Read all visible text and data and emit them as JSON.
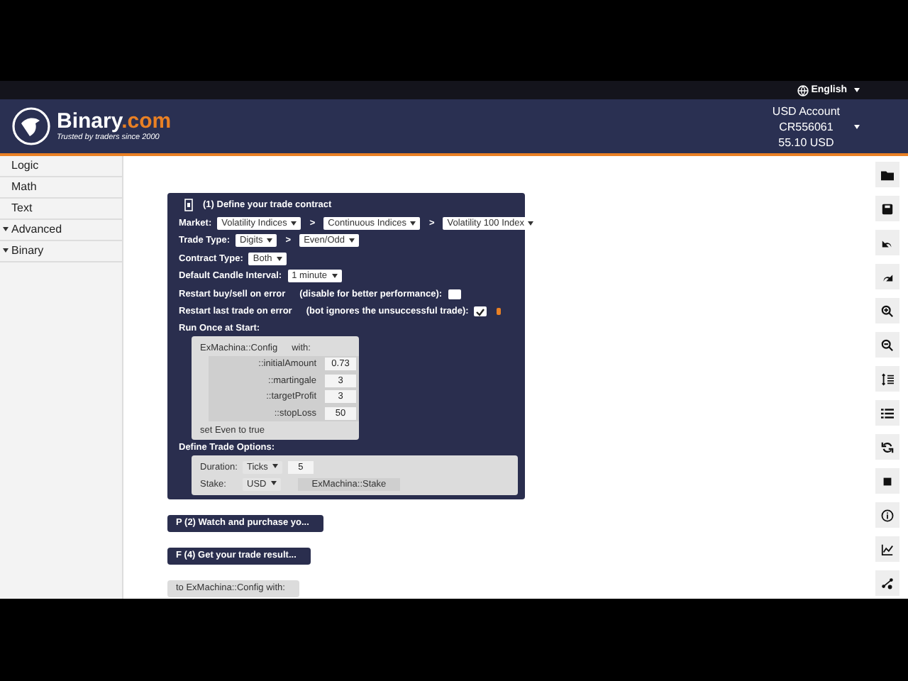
{
  "top_bar": {
    "language": "English"
  },
  "header": {
    "brand": "Binary",
    "brand_suffix": ".com",
    "tagline": "Trusted by traders since 2000",
    "account": {
      "type": "USD Account",
      "id": "CR556061",
      "balance": "55.10 USD"
    }
  },
  "sidebar": {
    "items": [
      {
        "label": "Logic",
        "kind": "plain"
      },
      {
        "label": "Math",
        "kind": "plain"
      },
      {
        "label": "Text",
        "kind": "plain"
      },
      {
        "label": "Advanced",
        "kind": "folder"
      },
      {
        "label": "Binary",
        "kind": "folder"
      }
    ]
  },
  "trade_block": {
    "title": "(1) Define your trade contract",
    "separator": ">",
    "market": {
      "label": "Market:",
      "choices": [
        "Volatility Indices",
        "Continuous Indices",
        "Volatility 100 Index"
      ]
    },
    "trade_type": {
      "label": "Trade Type:",
      "choices": [
        "Digits",
        "Even/Odd"
      ]
    },
    "contract_type": {
      "label": "Contract Type:",
      "choices": [
        "Both"
      ]
    },
    "candle_interval": {
      "label": "Default Candle Interval:",
      "choices": [
        "1 minute"
      ]
    },
    "options": [
      {
        "label": "Restart buy/sell on error",
        "note": "(disable for better performance):",
        "checked": false,
        "flag": false
      },
      {
        "label": "Restart last trade on error",
        "note": "(bot ignores the unsuccessful trade):",
        "checked": true,
        "flag": true
      }
    ],
    "run_once": {
      "label": "Run Once at Start:",
      "call": "ExMachina::Config",
      "with": "with:",
      "params": [
        {
          "name": "::initialAmount",
          "value": "0.73"
        },
        {
          "name": "::martingale",
          "value": "3"
        },
        {
          "name": "::targetProfit",
          "value": "3"
        },
        {
          "name": "::stopLoss",
          "value": "50"
        }
      ],
      "statement": "set Even to true"
    },
    "trade_options": {
      "label": "Define Trade Options:",
      "duration_label": "Duration:",
      "duration_unit": "Ticks",
      "duration_value": "5",
      "stake_label": "Stake:",
      "currency": "USD",
      "stake_value": "ExMachina::Stake"
    }
  },
  "collapsed_blocks": [
    {
      "text": "P (2) Watch and purchase yo...",
      "kind": "dark"
    },
    {
      "text": "F (4) Get your trade result...",
      "kind": "dark"
    },
    {
      "text": "to ExMachina::Config with:",
      "kind": "light"
    }
  ]
}
